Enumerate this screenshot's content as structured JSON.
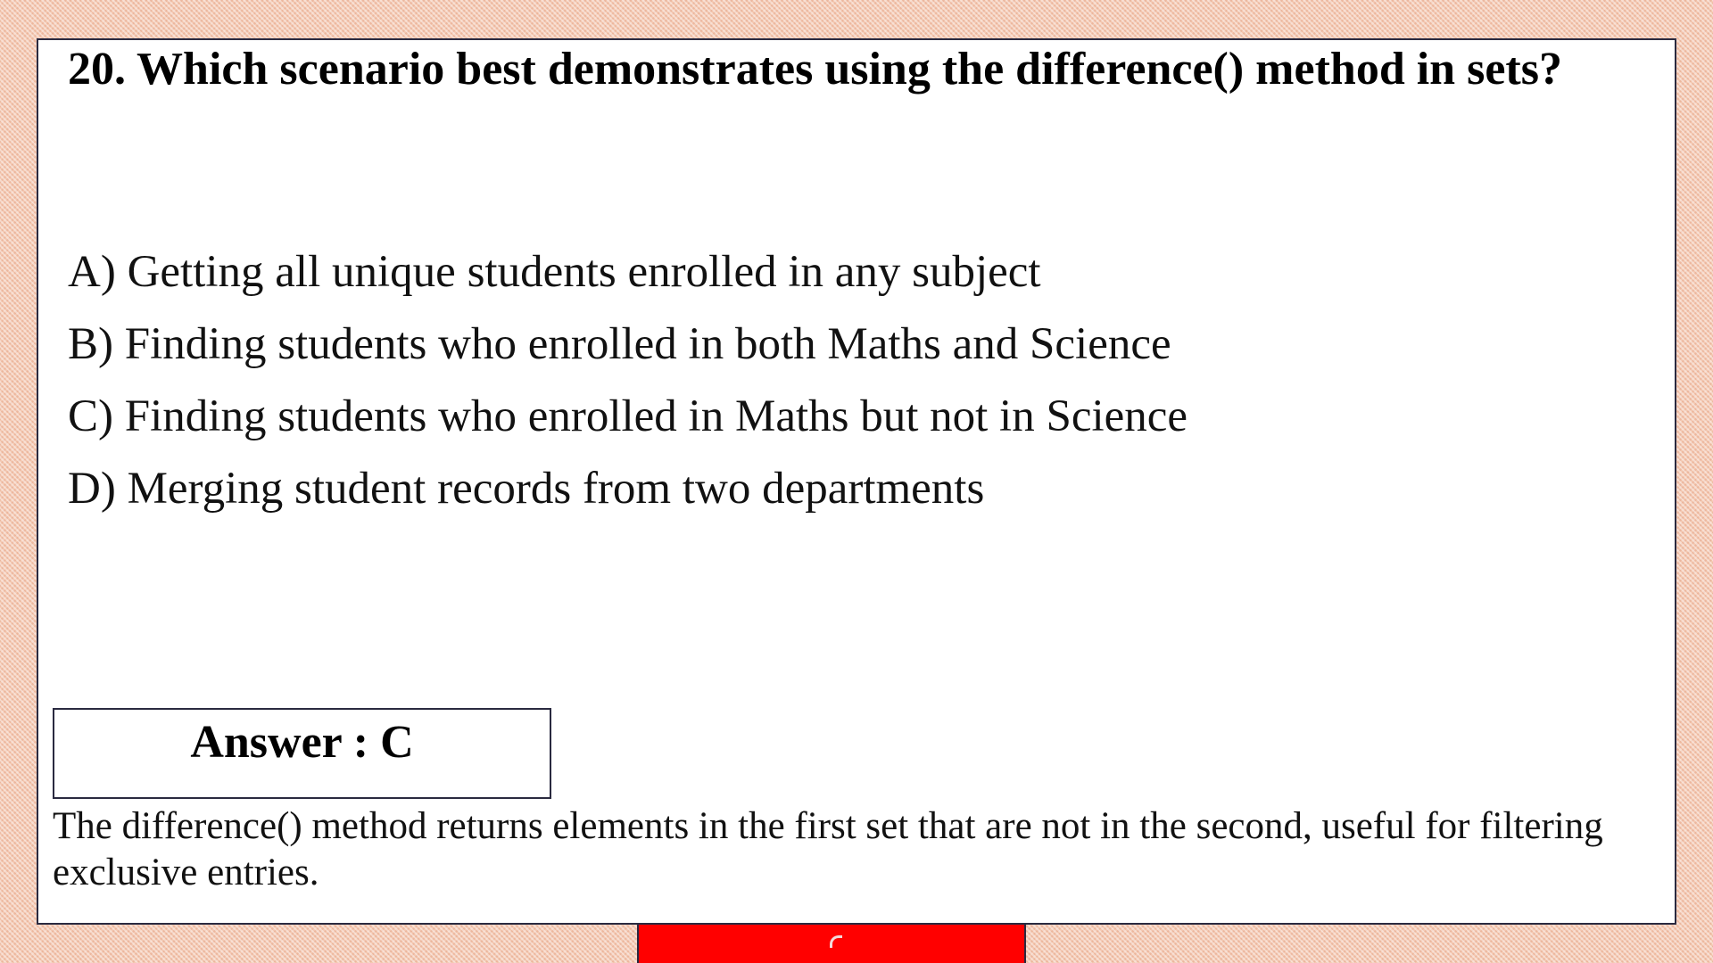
{
  "question": {
    "text": "20. Which scenario best demonstrates using the difference() method in sets?"
  },
  "options": [
    {
      "text": "A) Getting all unique students enrolled in any subject"
    },
    {
      "text": "B) Finding students who enrolled in both Maths and Science"
    },
    {
      "text": "C) Finding students who enrolled in Maths but not in Science"
    },
    {
      "text": "D) Merging student records from two departments"
    }
  ],
  "answer": {
    "text": "Answer : C"
  },
  "explanation": {
    "text": "The difference() method returns elements in the first set that are not in the second, useful for filtering exclusive entries."
  },
  "colors": {
    "background": "#f4c9b2",
    "slide": "#ffffff",
    "border": "#2a2a40",
    "bottom_bar": "#ff0000"
  }
}
